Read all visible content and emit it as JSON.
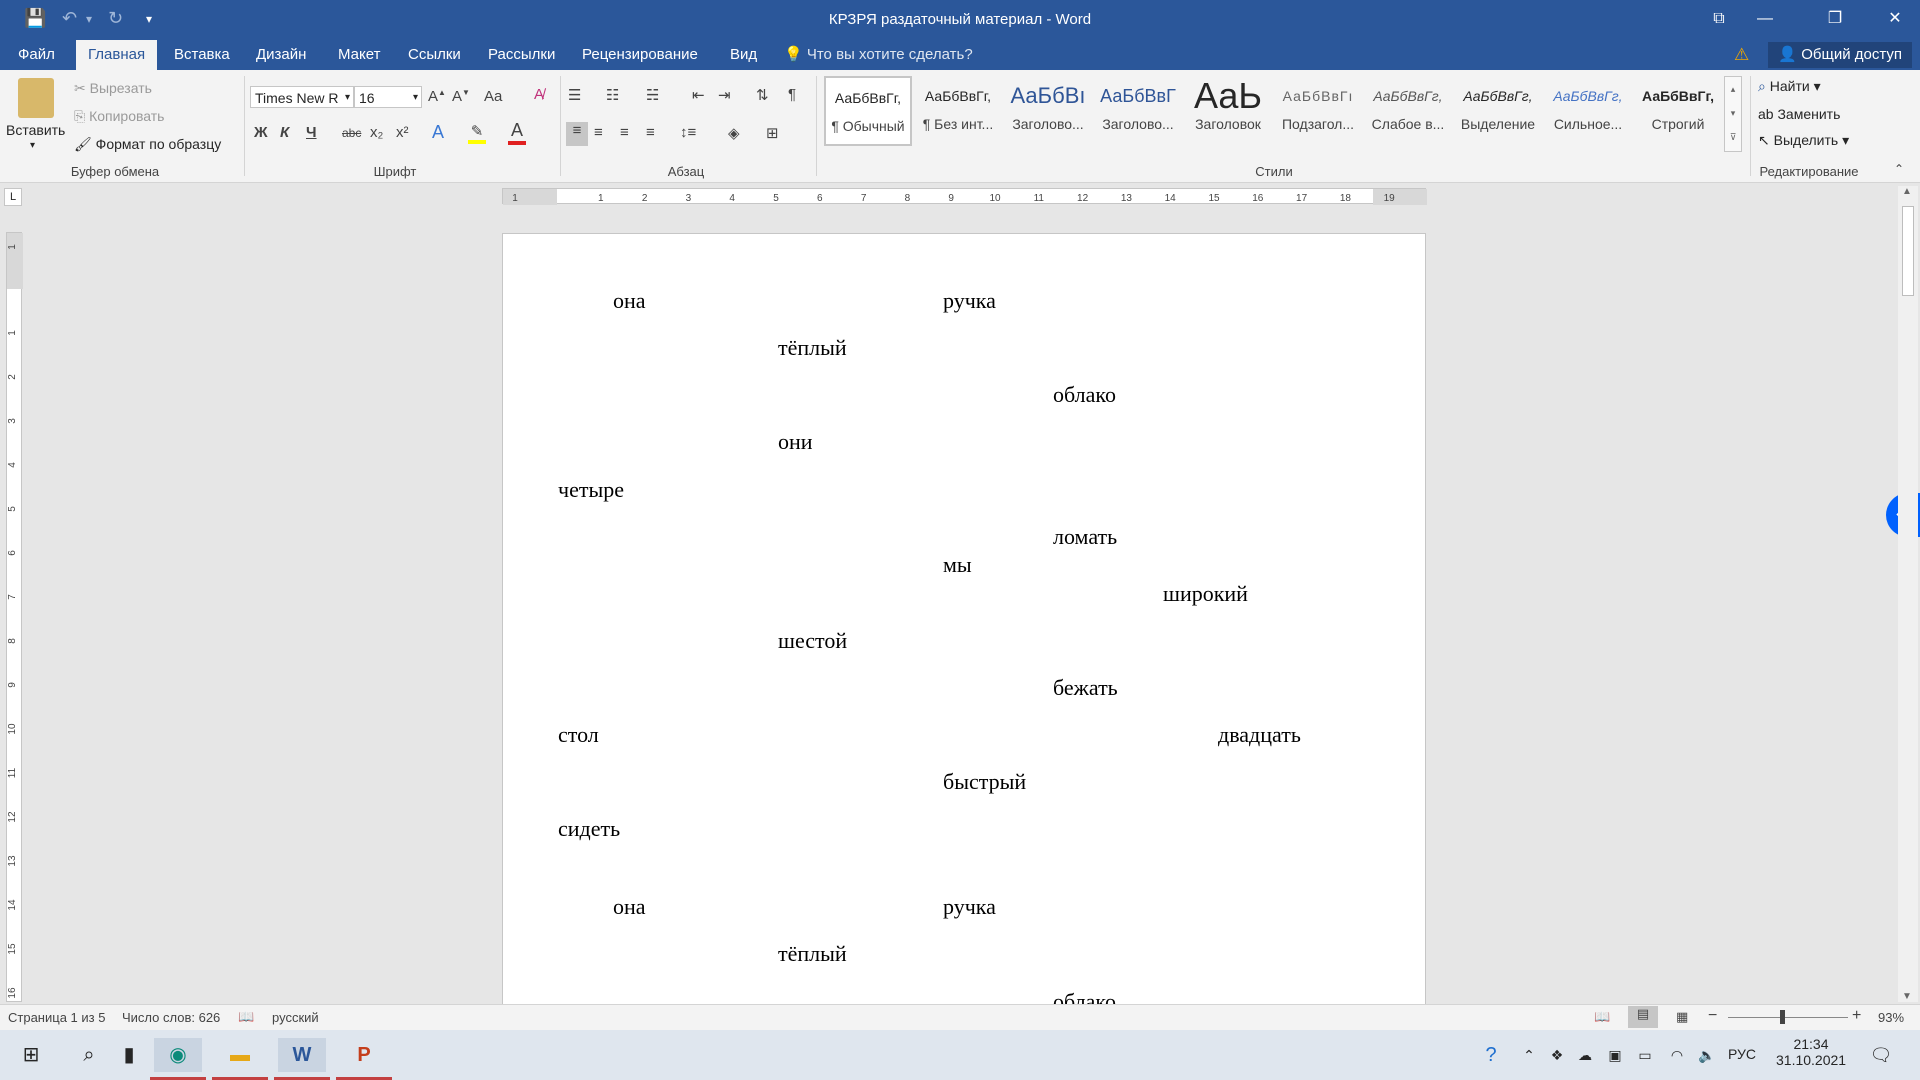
{
  "window": {
    "title": "КРЗРЯ раздаточный материал - Word"
  },
  "tabs": [
    {
      "label": "Файл"
    },
    {
      "label": "Главная"
    },
    {
      "label": "Вставка"
    },
    {
      "label": "Дизайн"
    },
    {
      "label": "Макет"
    },
    {
      "label": "Ссылки"
    },
    {
      "label": "Рассылки"
    },
    {
      "label": "Рецензирование"
    },
    {
      "label": "Вид"
    }
  ],
  "tell_me": "Что вы хотите сделать?",
  "share": "Общий доступ",
  "clipboard": {
    "paste": "Вставить",
    "cut": "Вырезать",
    "copy": "Копировать",
    "format_painter": "Формат по образцу",
    "group": "Буфер обмена"
  },
  "font": {
    "name": "Times New R",
    "size": "16",
    "group": "Шрифт",
    "bold": "Ж",
    "italic": "К",
    "underline": "Ч",
    "strike": "abc",
    "sub": "x₂",
    "sup": "x²",
    "case": "Aa"
  },
  "paragraph": {
    "group": "Абзац"
  },
  "styles": {
    "group": "Стили",
    "items": [
      {
        "preview": "АаБбВвГг,",
        "name": "¶ Обычный"
      },
      {
        "preview": "АаБбВвГг,",
        "name": "¶ Без инт..."
      },
      {
        "preview": "АаБбВı",
        "name": "Заголово..."
      },
      {
        "preview": "АаБбВвГ",
        "name": "Заголово..."
      },
      {
        "preview": "АаЬ",
        "name": "Заголовок"
      },
      {
        "preview": "АаБбВвГı",
        "name": "Подзагол..."
      },
      {
        "preview": "АаБбВвГг,",
        "name": "Слабое в..."
      },
      {
        "preview": "АаБбВвГг,",
        "name": "Выделение"
      },
      {
        "preview": "АаБбВвГг,",
        "name": "Сильное..."
      },
      {
        "preview": "АаБбВвГг,",
        "name": "Строгий"
      }
    ]
  },
  "editing": {
    "group": "Редактирование",
    "find": "Найти",
    "replace": "Заменить",
    "select": "Выделить"
  },
  "ruler": {
    "h_ticks": [
      "1",
      "1",
      "2",
      "3",
      "4",
      "5",
      "6",
      "7",
      "8",
      "9",
      "10",
      "11",
      "12",
      "13",
      "14",
      "15",
      "16",
      "17",
      "18",
      "19"
    ],
    "v_ticks": [
      "1",
      "1",
      "2",
      "3",
      "4",
      "5",
      "6",
      "7",
      "8",
      "9",
      "10",
      "11",
      "12",
      "13",
      "14",
      "15",
      "16"
    ]
  },
  "document": {
    "words": [
      "она",
      "ручка",
      "тёплый",
      "облако",
      "они",
      "четыре",
      "ломать",
      "мы",
      "широкий",
      "шестой",
      "бежать",
      "стол",
      "двадцать",
      "быстрый",
      "сидеть",
      "она",
      "ручка",
      "тёплый",
      "облако"
    ]
  },
  "status": {
    "page": "Страница 1 из 5",
    "words": "Число слов: 626",
    "language": "русский",
    "zoom": "93%"
  },
  "taskbar": {
    "lang": "РУС",
    "time": "21:34",
    "date": "31.10.2021"
  }
}
